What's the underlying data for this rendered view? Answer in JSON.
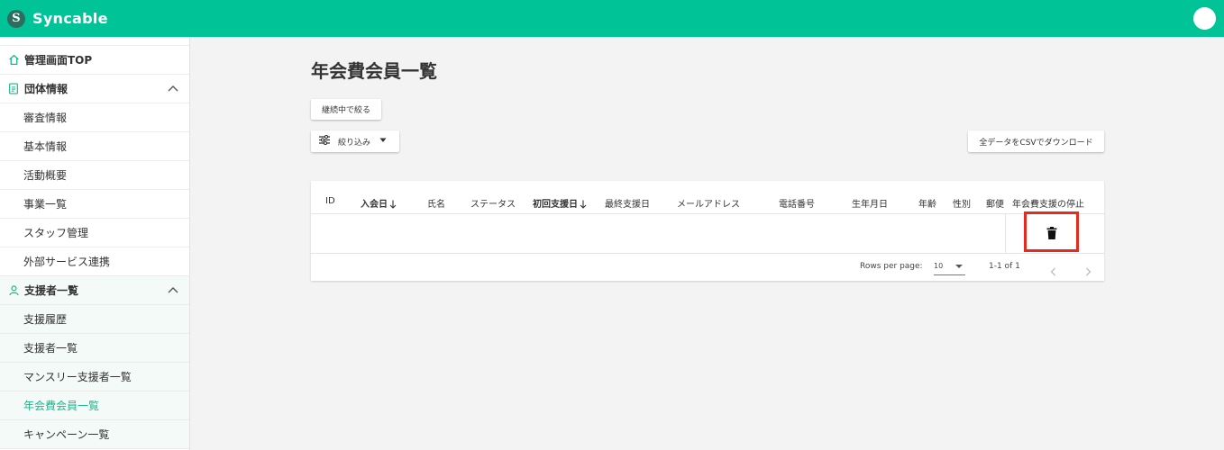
{
  "app": {
    "name": "Syncable",
    "logo_letter": "S"
  },
  "colors": {
    "brand": "#00c497",
    "active": "#17b88c",
    "highlight": "#e32b1f"
  },
  "sidebar": {
    "items": [
      {
        "label": "管理画面TOP",
        "icon": "home-icon"
      },
      {
        "label": "団体情報",
        "icon": "document-icon",
        "expanded": true
      },
      {
        "label": "審査情報"
      },
      {
        "label": "基本情報"
      },
      {
        "label": "活動概要"
      },
      {
        "label": "事業一覧"
      },
      {
        "label": "スタッフ管理"
      },
      {
        "label": "外部サービス連携"
      },
      {
        "label": "支援者一覧",
        "icon": "person-icon",
        "expanded": true
      },
      {
        "label": "支援履歴"
      },
      {
        "label": "支援者一覧"
      },
      {
        "label": "マンスリー支援者一覧"
      },
      {
        "label": "年会費会員一覧",
        "active": true
      },
      {
        "label": "キャンペーン一覧"
      }
    ]
  },
  "main": {
    "title": "年会費会員一覧",
    "narrow_button": "継続中で絞る",
    "filter_button": "絞り込み",
    "csv_button": "全データをCSVでダウンロード"
  },
  "table": {
    "columns": [
      "ID",
      "入会日",
      "氏名",
      "ステータス",
      "初回支援日",
      "最終支援日",
      "メールアドレス",
      "電話番号",
      "生年月日",
      "年齢",
      "性別",
      "郵便",
      "年会費支援の停止"
    ],
    "rows": [
      {
        "action_icon": "trash-icon"
      }
    ]
  },
  "pagination": {
    "rows_per_page_label": "Rows per page:",
    "rows_per_page_value": "10",
    "range": "1-1 of 1"
  }
}
